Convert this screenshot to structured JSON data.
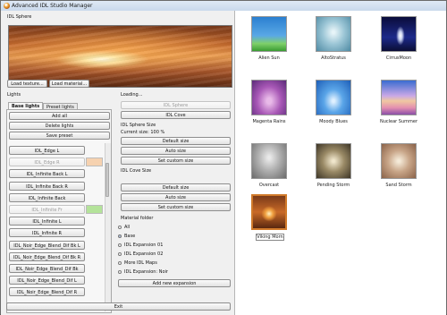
{
  "window": {
    "title": "Advanced IDL Studio Manager"
  },
  "sphere_panel": {
    "label": "IDL Sphere",
    "load_texture": "Load texture...",
    "load_material": "Load material..."
  },
  "lights": {
    "label": "Lights",
    "tabs": [
      "Base lights",
      "Preset lights"
    ],
    "add_all": "Add all",
    "delete_lights": "Delete lights",
    "save_preset": "Save preset",
    "items": [
      {
        "label": "IDL_Edge L",
        "disabled": false,
        "swatch": ""
      },
      {
        "label": "IDL_Edge R",
        "disabled": true,
        "swatch": "#f6d2b0"
      },
      {
        "label": "IDL_Infinite Back L",
        "disabled": false,
        "swatch": ""
      },
      {
        "label": "IDL_Infinite Back R",
        "disabled": false,
        "swatch": ""
      },
      {
        "label": "IDL_Infinite Back",
        "disabled": false,
        "swatch": ""
      },
      {
        "label": "IDL_Infinite Fr",
        "disabled": true,
        "swatch": "#b4e39a"
      },
      {
        "label": "IDL_Infinite L",
        "disabled": false,
        "swatch": ""
      },
      {
        "label": "IDL_Infinite R",
        "disabled": false,
        "swatch": ""
      },
      {
        "label": "IDL_Noir_Edge_Blend_Dif Bk L",
        "disabled": false,
        "swatch": ""
      },
      {
        "label": "IDL_Noir_Edge_Blend_Dif Bk R",
        "disabled": false,
        "swatch": ""
      },
      {
        "label": "IDL_Noir_Edge_Blend_Dif Bk",
        "disabled": false,
        "swatch": ""
      },
      {
        "label": "IDL_Noir_Edge_Blend_Dif L",
        "disabled": false,
        "swatch": ""
      },
      {
        "label": "IDL_Noir_Edge_Blend_Dif R",
        "disabled": false,
        "swatch": ""
      }
    ]
  },
  "controls": {
    "loading": "Loading...",
    "idl_sphere_btn": "IDL Sphere",
    "idl_cove_btn": "IDL Cove",
    "sphere_size_label": "IDL Sphere Size",
    "current_size": "Current size: 100 %",
    "default_size": "Default size",
    "auto_size": "Auto size",
    "set_custom_size": "Set custom size",
    "cove_size_label": "IDL Cove Size",
    "cove_default_size": "Default size",
    "cove_auto_size": "Auto size",
    "cove_set_custom_size": "Set custom size",
    "material_folder_label": "Material folder",
    "material_options": [
      "All",
      "Base",
      "IDL Expansion 01",
      "IDL Expansion 02",
      "More IDL Maps",
      "IDL Expansion: Noir"
    ],
    "material_selected": 1,
    "add_expansion": "Add new expansion"
  },
  "exit_label": "Exit",
  "gallery": [
    {
      "name": "Alien Sun",
      "bg": "linear-gradient(#2b7fd0 0%, #5aa8e6 55%, #7fd06a 78%, #3a9c32 100%)",
      "selected": false
    },
    {
      "name": "AltoStratus",
      "bg": "radial-gradient(ellipse at 50% 45%, #e7f4f8 5%, #9cc6d6 45%, #4e8aa3 100%)",
      "selected": false
    },
    {
      "name": "CirrusMoon",
      "bg": "radial-gradient(ellipse 18% 40% at 55% 55%, #ffffff 0%, #c9d2f0 30%, rgba(40,40,120,0) 70%), linear-gradient(#0a0c3a, #1d2a8a 60%, #0b0d35)",
      "selected": false
    },
    {
      "name": "Magenta Rains",
      "bg": "radial-gradient(ellipse at 50% 60%, #e8b9e8 10%, #a858b6 50%, #5a2a78 100%)",
      "selected": false
    },
    {
      "name": "Moody Blues",
      "bg": "radial-gradient(ellipse at 50% 60%, #dff0ff 5%, #5aa5e8 40%, #1e5fb8 100%)",
      "selected": false
    },
    {
      "name": "Nuclear Summer",
      "bg": "linear-gradient(#3a6cd0 0%, #c9a8e6 45%, #f0c8a0 60%, #e48fb0 80%, #8a4fa8 100%)",
      "selected": false
    },
    {
      "name": "Overcast",
      "bg": "radial-gradient(ellipse at 50% 40%, #e9e9e9 5%, #b0b0b0 45%, #6a6a6a 100%)",
      "selected": false
    },
    {
      "name": "Pending Storm",
      "bg": "radial-gradient(ellipse at 50% 50%, #f0e6cc 5%, #9a8a66 45%, #3d3526 100%)",
      "selected": false
    },
    {
      "name": "Sand Storm",
      "bg": "radial-gradient(ellipse at 50% 50%, #f4ead8 5%, #c8a588 45%, #8a6248 100%)",
      "selected": false
    },
    {
      "name": "Viking Morn",
      "bg": "radial-gradient(ellipse 30% 30% at 50% 55%, #fff0c0 0%, #f0a040 40%, rgba(160,70,20,0) 80%), linear-gradient(#7a3a18, #c86a28 50%, #5a2810)",
      "selected": true
    }
  ]
}
